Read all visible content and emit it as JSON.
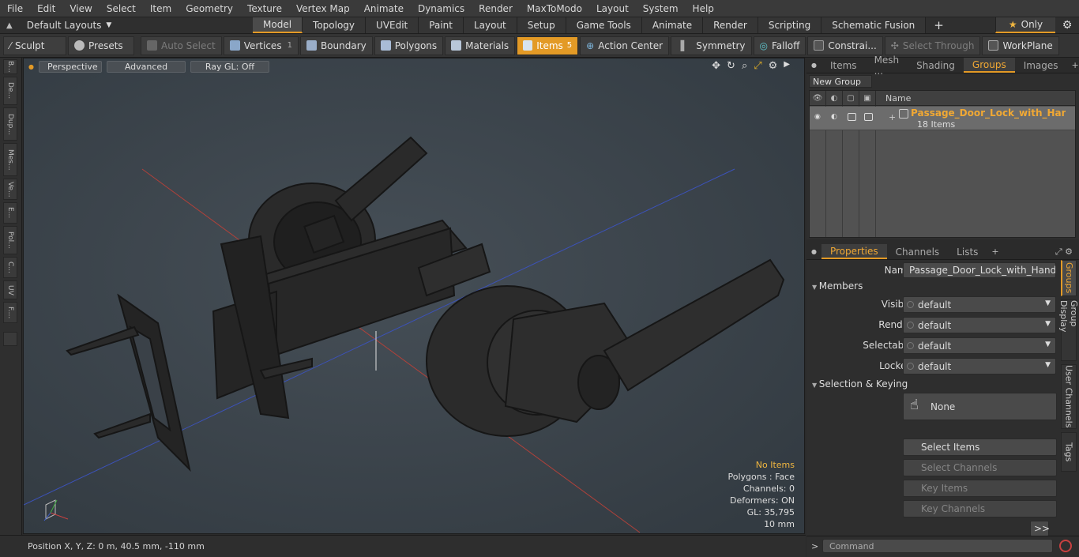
{
  "menu": [
    "File",
    "Edit",
    "View",
    "Select",
    "Item",
    "Geometry",
    "Texture",
    "Vertex Map",
    "Animate",
    "Dynamics",
    "Render",
    "MaxToModo",
    "Layout",
    "System",
    "Help"
  ],
  "layouts": {
    "label": "Default Layouts"
  },
  "tabs": [
    {
      "label": "Model",
      "active": true
    },
    {
      "label": "Topology"
    },
    {
      "label": "UVEdit"
    },
    {
      "label": "Paint"
    },
    {
      "label": "Layout"
    },
    {
      "label": "Setup"
    },
    {
      "label": "Game Tools"
    },
    {
      "label": "Animate"
    },
    {
      "label": "Render"
    },
    {
      "label": "Scripting"
    },
    {
      "label": "Schematic Fusion"
    }
  ],
  "only": {
    "label": "Only"
  },
  "toolbar": {
    "sculpt": "Sculpt",
    "presets": "Presets",
    "auto_select": "Auto Select",
    "vertices": "Vertices",
    "vertices_count": "1",
    "boundary": "Boundary",
    "polygons": "Polygons",
    "materials": "Materials",
    "items": "Items",
    "items_count": "5",
    "action_center": "Action Center",
    "symmetry": "Symmetry",
    "falloff": "Falloff",
    "constraints": "Constrai...",
    "select_through": "Select Through",
    "workplane": "WorkPlane"
  },
  "left_tabs": [
    "B...",
    "De...",
    "Dup...",
    "Mes...",
    "Ve...",
    "E...",
    "Pol...",
    "C...",
    "UV",
    "F...."
  ],
  "viewport": {
    "perspective": "Perspective",
    "advanced": "Advanced",
    "raygl": "Ray GL: Off",
    "stats": {
      "items": "No Items",
      "polygons": "Polygons : Face",
      "channels": "Channels: 0",
      "deformers": "Deformers: ON",
      "gl": "GL: 35,795",
      "scale": "10 mm"
    }
  },
  "status": {
    "position": "Position X, Y, Z:  0 m, 40.5 mm, -110 mm"
  },
  "top_panel": {
    "tabs": [
      {
        "label": "Items"
      },
      {
        "label": "Mesh ..."
      },
      {
        "label": "Shading"
      },
      {
        "label": "Groups",
        "active": true
      },
      {
        "label": "Images"
      }
    ],
    "new_group": "New Group",
    "col_name": "Name",
    "group_name": "Passage_Door_Lock_with_Hand...",
    "group_count": "18 Items"
  },
  "props": {
    "tabs": [
      {
        "label": "Properties",
        "active": true
      },
      {
        "label": "Channels"
      },
      {
        "label": "Lists"
      }
    ],
    "name_label": "Name",
    "name_value": "Passage_Door_Lock_with_Handle_Silv",
    "members": "Members",
    "visible_label": "Visible",
    "visible_value": "default",
    "render_label": "Render",
    "render_value": "default",
    "selectable_label": "Selectable",
    "selectable_value": "default",
    "locked_label": "Locked",
    "locked_value": "default",
    "sel_keying": "Selection & Keying",
    "none": "None",
    "select_items": "Select Items",
    "select_channels": "Select Channels",
    "key_items": "Key Items",
    "key_channels": "Key Channels",
    "more": ">>"
  },
  "side_tabs": [
    {
      "label": "Groups",
      "active": true
    },
    {
      "label": "Group Display"
    },
    {
      "label": "User Channels"
    },
    {
      "label": "Tags"
    }
  ],
  "command": {
    "placeholder": "Command",
    "prompt": ">"
  },
  "colors": {
    "accent": "#e39a26",
    "highlight": "#f0a834",
    "viewport_bg": "#3d454c"
  }
}
